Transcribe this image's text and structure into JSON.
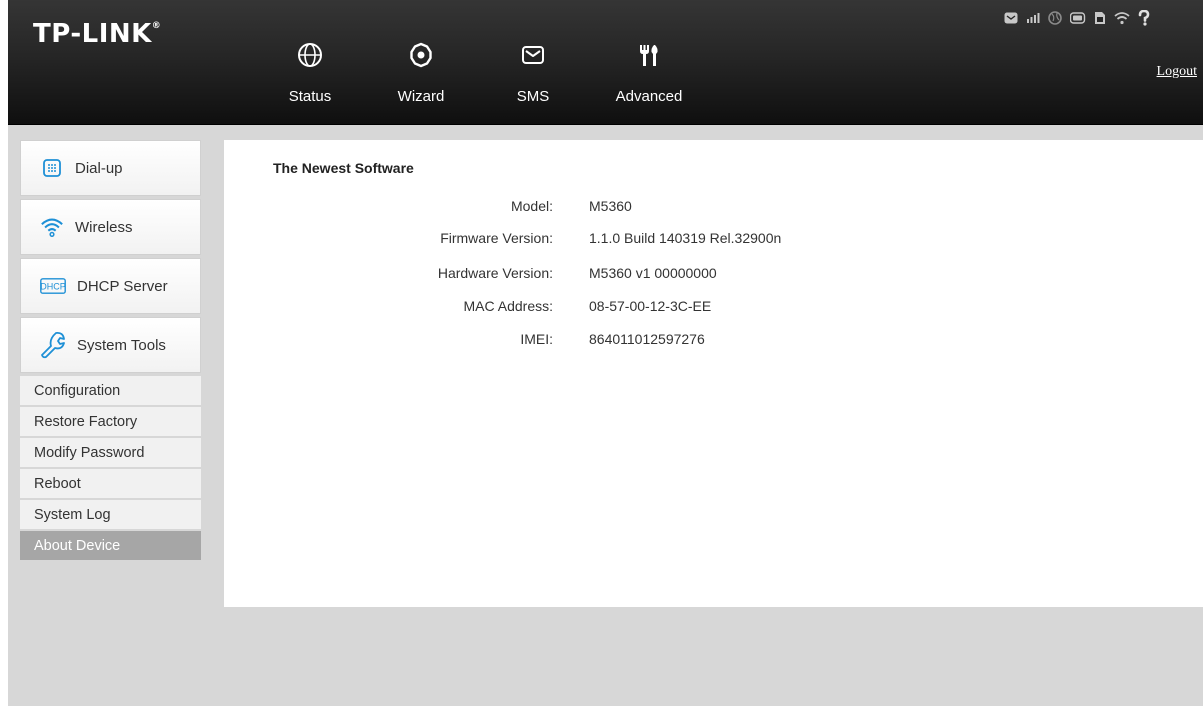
{
  "header": {
    "brand": "TP-LINK",
    "brand_mark": "®",
    "logout": "Logout",
    "status_icons": [
      "envelope-icon",
      "signal-bars-icon",
      "globe-icon",
      "battery-icon",
      "sim-card-icon",
      "wifi-icon",
      "help-icon"
    ]
  },
  "nav": [
    {
      "label": "Status",
      "icon": "globe-icon"
    },
    {
      "label": "Wizard",
      "icon": "gear-icon"
    },
    {
      "label": "SMS",
      "icon": "envelope-icon"
    },
    {
      "label": "Advanced",
      "icon": "tools-icon",
      "active": true
    }
  ],
  "sidebar": {
    "groups": [
      {
        "label": "Dial-up",
        "icon": "dialpad-icon"
      },
      {
        "label": "Wireless",
        "icon": "wifi-icon"
      },
      {
        "label": "DHCP Server",
        "icon": "dhcp-icon",
        "icon_text": "DHCP"
      },
      {
        "label": "System Tools",
        "icon": "wrench-icon"
      }
    ],
    "sub_items": [
      {
        "label": "Configuration"
      },
      {
        "label": "Restore Factory"
      },
      {
        "label": "Modify Password"
      },
      {
        "label": "Reboot"
      },
      {
        "label": "System Log"
      },
      {
        "label": "About Device",
        "active": true
      }
    ]
  },
  "content": {
    "title": "The Newest Software",
    "rows": [
      {
        "label": "Model:",
        "value": "M5360"
      },
      {
        "label": "Firmware Version:",
        "value": "1.1.0 Build 140319 Rel.32900n"
      },
      {
        "label": "Hardware Version:",
        "value": "M5360 v1 00000000"
      },
      {
        "label": "MAC Address:",
        "value": "08-57-00-12-3C-EE"
      },
      {
        "label": "IMEI:",
        "value": "864011012597276"
      }
    ]
  },
  "colors": {
    "header_bg": "#1a1a1a",
    "page_bg": "#d7d7d7",
    "active_item": "#a6a6a6",
    "icon_blue": "#1e90d6"
  }
}
